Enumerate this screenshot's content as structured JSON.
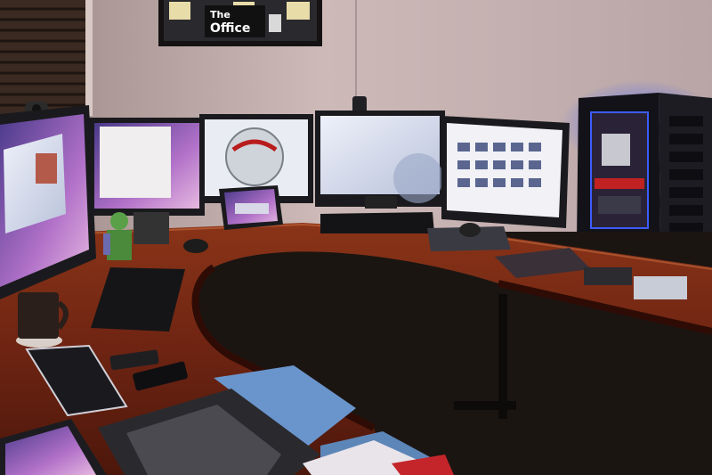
{
  "poster": {
    "line1": "The",
    "line2": "Office"
  },
  "colors": {
    "wall": "#c9b6b4",
    "wall_dark": "#8f7d7d",
    "desk": "#7a2a16",
    "desk_highlight": "#b5532f",
    "floor": "#1b1512",
    "screen_glow": "#dfe6f4",
    "towel": "#5f8bc2",
    "pc_case": "#1c1c22",
    "pc_led": "#3d5cff"
  },
  "icons": [
    "webcam-icon",
    "speaker-icon",
    "toy-figure-icon"
  ]
}
